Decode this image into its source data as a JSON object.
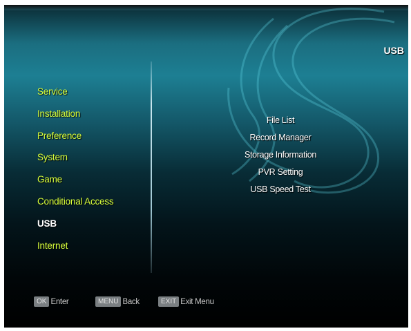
{
  "screen": {
    "title": "USB"
  },
  "menu": {
    "items": [
      {
        "label": "Service"
      },
      {
        "label": "Installation"
      },
      {
        "label": "Preference"
      },
      {
        "label": "System"
      },
      {
        "label": "Game"
      },
      {
        "label": "Conditional Access"
      },
      {
        "label": "USB",
        "selected": true
      },
      {
        "label": "Internet"
      }
    ]
  },
  "submenu": {
    "items": [
      {
        "label": "File List"
      },
      {
        "label": "Record Manager"
      },
      {
        "label": "Storage Information"
      },
      {
        "label": "PVR Setting"
      },
      {
        "label": "USB Speed Test"
      }
    ]
  },
  "footer": {
    "hints": [
      {
        "key": "OK",
        "label": "Enter"
      },
      {
        "key": "MENU",
        "label": "Back"
      },
      {
        "key": "EXIT",
        "label": "Exit Menu"
      }
    ]
  },
  "colors": {
    "menu_text": "#d8ff3c",
    "selected_text": "#ffffff",
    "submenu_text": "#ffffff",
    "key_badge": "#7a7f82",
    "background_top": "#1d7f93",
    "background_bottom": "#000000"
  },
  "icons": [
    "brand-swirl-logo"
  ]
}
